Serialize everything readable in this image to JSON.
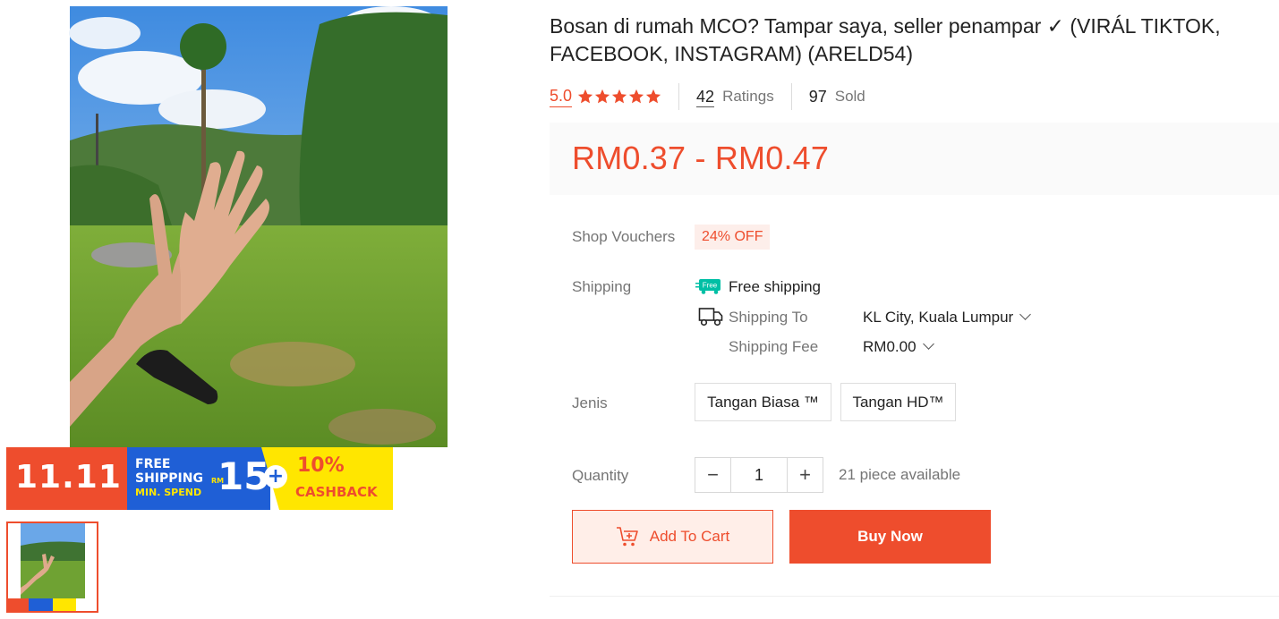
{
  "product": {
    "title": "Bosan di rumah MCO? Tampar saya, seller penampar ✓ (VIRÁL TIKTOK, FACEBOOK, INSTAGRAM) (ARELD54)",
    "rating": "5.0",
    "ratings_count": "42",
    "ratings_label": "Ratings",
    "sold_count": "97",
    "sold_label": "Sold",
    "price": "RM0.37 - RM0.47",
    "stars": 5
  },
  "banner": {
    "event": "11.11",
    "free": "FREE",
    "shipping": "SHIPPING",
    "min_spend": "MIN. SPEND",
    "currency": "RM",
    "amount": "15",
    "plus": "+",
    "cashback_pct": "10%",
    "cashback": "CASHBACK"
  },
  "vouchers": {
    "label": "Shop Vouchers",
    "badge": "24% OFF"
  },
  "shipping": {
    "label": "Shipping",
    "free_icon_text": "Free",
    "free_text": "Free shipping",
    "to_label": "Shipping To",
    "to_value": "KL City, Kuala Lumpur",
    "fee_label": "Shipping Fee",
    "fee_value": "RM0.00"
  },
  "variants": {
    "label": "Jenis",
    "options": [
      "Tangan Biasa ™",
      "Tangan HD™"
    ]
  },
  "quantity": {
    "label": "Quantity",
    "minus": "−",
    "value": "1",
    "plus": "+",
    "available": "21 piece available"
  },
  "actions": {
    "add_to_cart": "Add To Cart",
    "buy_now": "Buy Now"
  },
  "colors": {
    "brand": "#ee4d2d",
    "free_ship": "#00bfa5",
    "banner_blue": "#1f5fd6",
    "banner_yellow": "#ffe600"
  }
}
